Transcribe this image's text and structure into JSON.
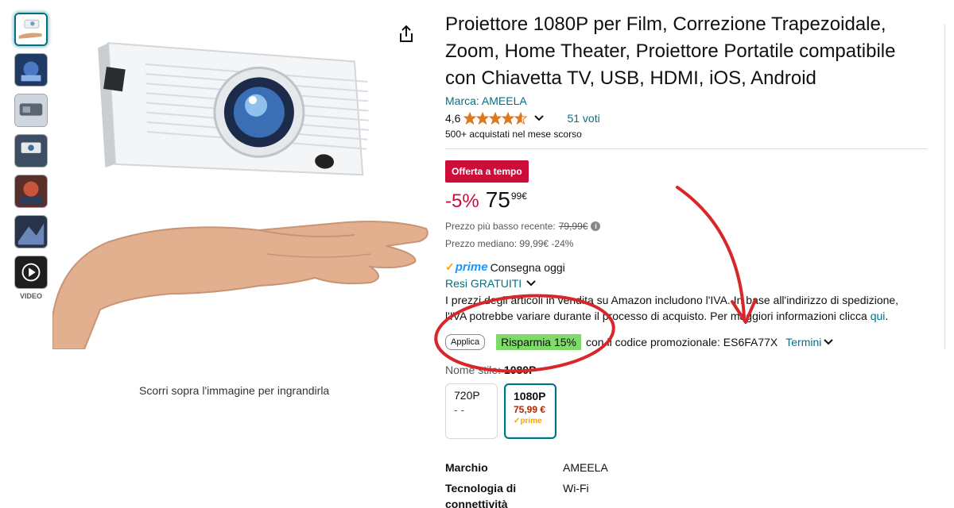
{
  "product": {
    "title": "Proiettore 1080P per Film, Correzione Trapezoidale, Zoom, Home Theater, Proiettore Portatile compatibile con Chiavetta TV, USB, HDMI, iOS, Android",
    "brand_link": "Marca: AMEELA",
    "rating_value": "4,6",
    "rating_stars": 4.6,
    "votes": "51 voti",
    "bought": "500+ acquistati nel mese scorso"
  },
  "pricing": {
    "deal_badge": "Offerta a tempo",
    "discount": "-5%",
    "price_whole": "75",
    "price_fraction": "99",
    "currency": "€",
    "lowest_label": "Prezzo più basso recente:",
    "lowest_price": "79,99€",
    "median": "Prezzo mediano: 99,99€ -24%"
  },
  "delivery": {
    "prime_check": "✓",
    "prime_text": "prime",
    "prime_delivery": "Consegna oggi",
    "returns": "Resi GRATUITI",
    "vat_note": "I prezzi degli articoli in vendita su Amazon includono l'IVA. In base all'indirizzo di spedizione, l'IVA potrebbe variare durante il processo di acquisto. Per maggiori informazioni clicca",
    "vat_link": "qui",
    "vat_end": "."
  },
  "promo": {
    "apply_label": "Applica",
    "save_label": "Risparmia 15%",
    "code_text": "con il codice promozionale: ES6FA77X",
    "terms": "Termini"
  },
  "style": {
    "label": "Nome stile:",
    "selected": "1080P",
    "variants": [
      {
        "name": "720P",
        "price": "- -"
      },
      {
        "name": "1080P",
        "price": "75,99 €",
        "prime": "prime"
      }
    ]
  },
  "specs": [
    {
      "key": "Marchio",
      "value": "AMEELA"
    },
    {
      "key": "Tecnologia di connettività",
      "value": "Wi-Fi"
    }
  ],
  "gallery": {
    "video_label": "VIDEO",
    "zoom_hint": "Scorri sopra l'immagine per ingrandirla"
  },
  "colors": {
    "link": "#007185",
    "deal": "#cc0c39",
    "save_badge": "#7fda69",
    "annotation": "#d9262b",
    "star": "#de7921"
  }
}
